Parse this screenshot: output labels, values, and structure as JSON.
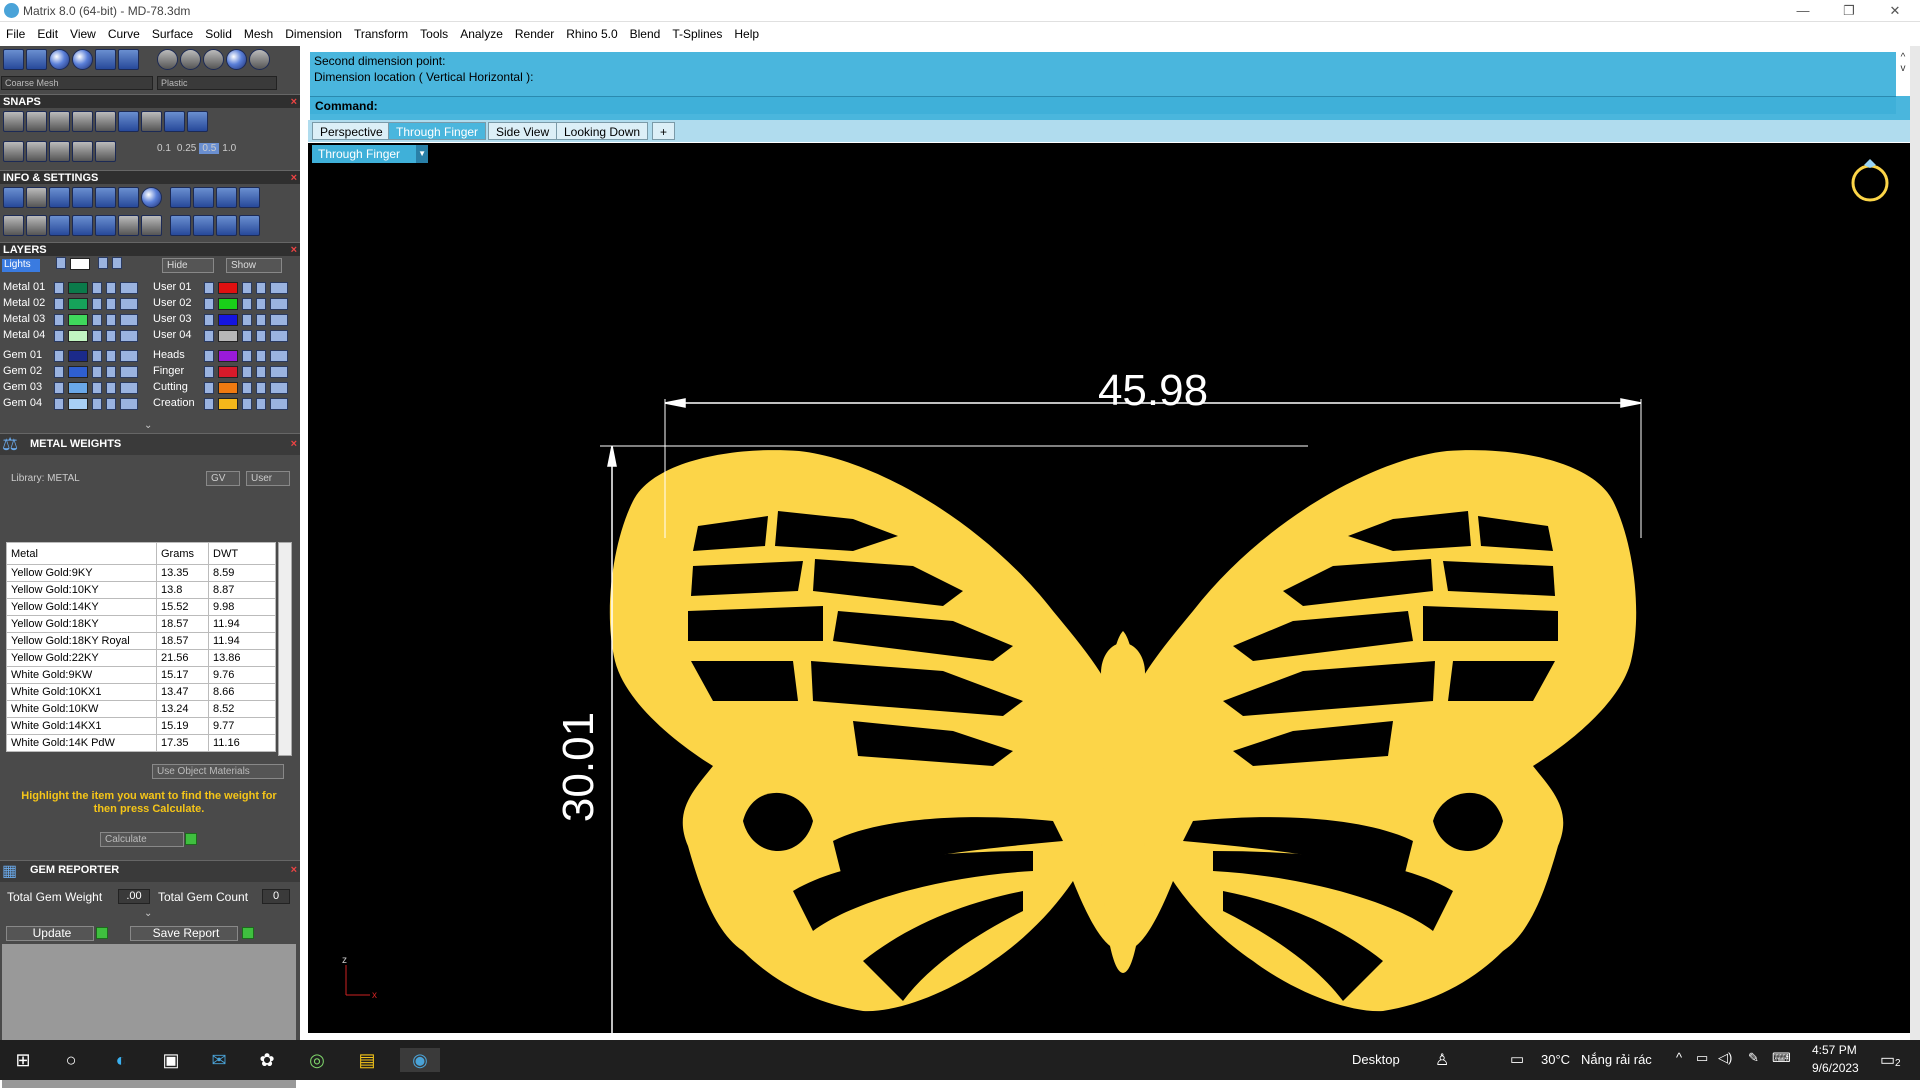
{
  "window": {
    "title": "Matrix 8.0 (64-bit) - MD-78.3dm",
    "min": "—",
    "restore": "❐",
    "close": "✕"
  },
  "menu": [
    "File",
    "Edit",
    "View",
    "Curve",
    "Surface",
    "Solid",
    "Mesh",
    "Dimension",
    "Transform",
    "Tools",
    "Analyze",
    "Render",
    "Rhino 5.0",
    "Blend",
    "T-Splines",
    "Help"
  ],
  "toolbar": {
    "mesh_select": "Coarse Mesh",
    "material_select": "Plastic"
  },
  "snaps": {
    "title": "SNAPS",
    "values": [
      "0.1",
      "0.25",
      "0.5",
      "1.0"
    ]
  },
  "info": {
    "title": "INFO & SETTINGS"
  },
  "layers": {
    "title": "LAYERS",
    "lights": "Lights",
    "hide": "Hide",
    "show": "Show",
    "left": [
      {
        "name": "Metal 01",
        "color": "#0b7a4a"
      },
      {
        "name": "Metal 02",
        "color": "#16a35a"
      },
      {
        "name": "Metal 03",
        "color": "#3fd85c"
      },
      {
        "name": "Metal 04",
        "color": "#c2f5c2"
      },
      {
        "name": "Gem 01",
        "color": "#1b2a8a"
      },
      {
        "name": "Gem 02",
        "color": "#2f5fd0"
      },
      {
        "name": "Gem 03",
        "color": "#6aa8e8"
      },
      {
        "name": "Gem 04",
        "color": "#a8d0f5"
      }
    ],
    "right": [
      {
        "name": "User 01",
        "color": "#e01010"
      },
      {
        "name": "User 02",
        "color": "#19d019"
      },
      {
        "name": "User 03",
        "color": "#1515e0"
      },
      {
        "name": "User 04",
        "color": "#b8b8b8"
      },
      {
        "name": "Heads",
        "color": "#9a1ad8"
      },
      {
        "name": "Finger",
        "color": "#d81a2a"
      },
      {
        "name": "Cutting",
        "color": "#f07a10"
      },
      {
        "name": "Creation",
        "color": "#f5b81a"
      }
    ]
  },
  "metal_weights": {
    "title": "METAL WEIGHTS",
    "library": "Library: METAL",
    "gv": "GV",
    "user": "User",
    "columns": [
      "Metal",
      "Grams",
      "DWT"
    ],
    "rows": [
      [
        "Yellow Gold:9KY",
        "13.35",
        "8.59"
      ],
      [
        "Yellow Gold:10KY",
        "13.8",
        "8.87"
      ],
      [
        "Yellow Gold:14KY",
        "15.52",
        "9.98"
      ],
      [
        "Yellow Gold:18KY",
        "18.57",
        "11.94"
      ],
      [
        "Yellow Gold:18KY Royal",
        "18.57",
        "11.94"
      ],
      [
        "Yellow Gold:22KY",
        "21.56",
        "13.86"
      ],
      [
        "White Gold:9KW",
        "15.17",
        "9.76"
      ],
      [
        "White Gold:10KX1",
        "13.47",
        "8.66"
      ],
      [
        "White Gold:10KW",
        "13.24",
        "8.52"
      ],
      [
        "White Gold:14KX1",
        "15.19",
        "9.77"
      ],
      [
        "White Gold:14K PdW",
        "17.35",
        "11.16"
      ]
    ],
    "use_object_materials": "Use Object Materials",
    "hint": "Highlight the item you want to find the weight for then press Calculate.",
    "calculate": "Calculate"
  },
  "gem_reporter": {
    "title": "GEM REPORTER",
    "weight_label": "Total Gem Weight",
    "weight_value": ".00",
    "count_label": "Total Gem Count",
    "count_value": "0",
    "update": "Update",
    "save_report": "Save Report"
  },
  "command": {
    "line1": "Second dimension point:",
    "line2": "Dimension location ( Vertical  Horizontal ):",
    "prompt": "Command:"
  },
  "viewport_tabs": [
    "Perspective",
    "Through Finger",
    "Side View",
    "Looking Down",
    "+"
  ],
  "active_view": "Through Finger",
  "dimensions": {
    "width": "45.98",
    "height": "30.01"
  },
  "axis": {
    "z": "z",
    "x": "x"
  },
  "taskbar": {
    "desktop": "Desktop",
    "temp": "30°C",
    "weather": "Nắng rải rác",
    "time": "4:57 PM",
    "date": "9/6/2023",
    "notif": "2"
  }
}
